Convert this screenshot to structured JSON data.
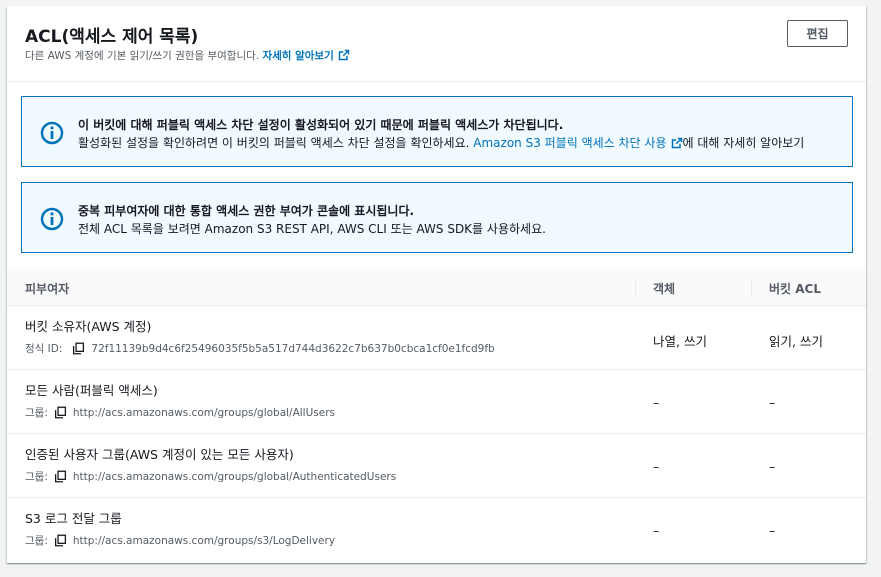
{
  "header": {
    "title": "ACL(액세스 제어 목록)",
    "description": "다른 AWS 계정에 기본 읽기/쓰기 권한을 부여합니다.",
    "learn_more": "자세히 알아보기",
    "edit_label": "편집"
  },
  "alerts": [
    {
      "title": "이 버킷에 대해 퍼블릭 액세스 차단 설정이 활성화되어 있기 때문에 퍼블릭 액세스가 차단됩니다.",
      "body_prefix": "활성화된 설정을 확인하려면 이 버킷의 퍼블릭 액세스 차단 설정을 확인하세요.",
      "link": "Amazon S3 퍼블릭 액세스 차단 사용",
      "body_suffix": "에 대해 자세히 알아보기"
    },
    {
      "title": "중복 피부여자에 대한 통합 액세스 권한 부여가 콘솔에 표시됩니다.",
      "body": "전체 ACL 목록을 보려면 Amazon S3 REST API, AWS CLI 또는 AWS SDK를 사용하세요."
    }
  ],
  "table": {
    "columns": [
      "피부여자",
      "객체",
      "버킷 ACL"
    ],
    "rows": [
      {
        "grantee": "버킷 소유자(AWS 계정)",
        "id_label": "정식 ID:",
        "id_value": "72f11139b9d4c6f25496035f5b5a517d744d3622c7b637b0cbca1cf0e1fcd9fb",
        "object": "나열, 쓰기",
        "bucket_acl": "읽기, 쓰기"
      },
      {
        "grantee": "모든 사람(퍼블릭 액세스)",
        "id_label": "그룹:",
        "id_value": "http://acs.amazonaws.com/groups/global/AllUsers",
        "object": "–",
        "bucket_acl": "–"
      },
      {
        "grantee": "인증된 사용자 그룹(AWS 계정이 있는 모든 사용자)",
        "id_label": "그룹:",
        "id_value": "http://acs.amazonaws.com/groups/global/AuthenticatedUsers",
        "object": "–",
        "bucket_acl": "–"
      },
      {
        "grantee": "S3 로그 전달 그룹",
        "id_label": "그룹:",
        "id_value": "http://acs.amazonaws.com/groups/s3/LogDelivery",
        "object": "–",
        "bucket_acl": "–"
      }
    ]
  },
  "icons": {
    "info": "info-circle-icon",
    "external": "external-link-icon",
    "copy": "copy-icon"
  },
  "colors": {
    "link": "#0073bb",
    "info_border": "#0073bb",
    "info_bg": "#f1faff",
    "text": "#16191f",
    "muted": "#545b64"
  }
}
